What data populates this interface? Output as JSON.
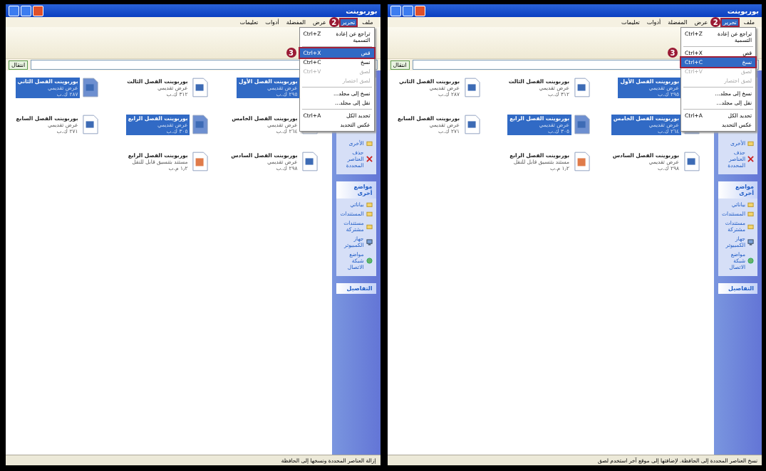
{
  "left_window": {
    "title": "بوربوينت",
    "menu": [
      {
        "label": "ملف",
        "selected": false
      },
      {
        "label": "تحرير",
        "selected": true
      },
      {
        "label": "عرض",
        "selected": false
      },
      {
        "label": "المفضلة",
        "selected": false
      },
      {
        "label": "أدوات",
        "selected": false
      },
      {
        "label": "تعليمات",
        "selected": false
      }
    ],
    "edit_menu": [
      {
        "kind": "item",
        "label": "تراجع عن إعادة التسمية",
        "shortcut": "Ctrl+Z",
        "selected": false,
        "disabled": false
      },
      {
        "kind": "separator"
      },
      {
        "kind": "item",
        "label": "قص",
        "shortcut": "Ctrl+X",
        "selected": true,
        "disabled": false
      },
      {
        "kind": "item",
        "label": "نسخ",
        "shortcut": "Ctrl+C",
        "selected": false,
        "disabled": false
      },
      {
        "kind": "item",
        "label": "لصق",
        "shortcut": "Ctrl+V",
        "selected": false,
        "disabled": true
      },
      {
        "kind": "item",
        "label": "لصق اختصار",
        "selected": false,
        "disabled": true
      },
      {
        "kind": "separator"
      },
      {
        "kind": "item",
        "label": "نسخ إلى مجلد...",
        "selected": false,
        "disabled": false
      },
      {
        "kind": "item",
        "label": "نقل إلى مجلد...",
        "selected": false,
        "disabled": false
      },
      {
        "kind": "separator"
      },
      {
        "kind": "item",
        "label": "تحديد الكل",
        "shortcut": "Ctrl+A",
        "selected": false,
        "disabled": false
      },
      {
        "kind": "item",
        "label": "عكس التحديد",
        "selected": false,
        "disabled": false
      }
    ],
    "step_badges": [
      "2",
      "3"
    ],
    "go_button": "انتقال",
    "panels": [
      {
        "items": [
          {
            "kind": "folder",
            "label": "الأخرى"
          },
          {
            "kind": "delete",
            "label": "حذف العناصر المحددة"
          }
        ]
      },
      {
        "title": "مواضع أخرى",
        "items": [
          {
            "kind": "folder",
            "label": "بياناتي"
          },
          {
            "kind": "folder",
            "label": "المستندات"
          },
          {
            "kind": "folder",
            "label": "مستندات مشتركة"
          },
          {
            "kind": "computer",
            "label": "جهاز الكمبيوتر"
          },
          {
            "kind": "network",
            "label": "مواضع شبكة الاتصال"
          }
        ]
      },
      {
        "title": "التفاصيل"
      }
    ],
    "files": [
      {
        "name": "بوربوينت الفصل الأول",
        "type": "عرض تقديمي",
        "size": "٢٩٥ ك.ب",
        "selected": true,
        "kind": "slides"
      },
      {
        "name": "بوربوينت الفصل الثالث",
        "type": "عرض تقديمي",
        "size": "٣١٢ ك.ب",
        "selected": false,
        "kind": "slides"
      },
      {
        "name": "بوربوينت الفصل الثاني",
        "type": "عرض تقديمي",
        "size": "٢٨٧ ك.ب",
        "selected": true,
        "kind": "slides"
      },
      {
        "name": "بوربوينت الفصل الخامس",
        "type": "عرض تقديمي",
        "size": "٢٦٤ ك.ب",
        "selected": false,
        "kind": "slides"
      },
      {
        "name": "بوربوينت الفصل الرابع",
        "type": "عرض تقديمي",
        "size": "٣٠٥ ك.ب",
        "selected": true,
        "kind": "slides"
      },
      {
        "name": "بوربوينت الفصل السابع",
        "type": "عرض تقديمي",
        "size": "٢٧١ ك.ب",
        "selected": false,
        "kind": "slides"
      },
      {
        "name": "بوربوينت الفصل السادس",
        "type": "عرض تقديمي",
        "size": "٢٩٨ ك.ب",
        "selected": false,
        "kind": "slides"
      },
      {
        "name": "بوربوينت الفصل الرابع",
        "type": "مستند بتنسيق قابل للنقل",
        "size": "١٫٢ م.ب",
        "selected": false,
        "kind": "pdf"
      }
    ],
    "status": "إزالة العناصر المحددة ونسخها إلى الحافظة"
  },
  "right_window": {
    "title": "بوربوينت",
    "menu": [
      {
        "label": "ملف",
        "selected": false
      },
      {
        "label": "تحرير",
        "selected": true
      },
      {
        "label": "عرض",
        "selected": false
      },
      {
        "label": "المفضلة",
        "selected": false
      },
      {
        "label": "أدوات",
        "selected": false
      },
      {
        "label": "تعليمات",
        "selected": false
      }
    ],
    "edit_menu": [
      {
        "kind": "item",
        "label": "تراجع عن إعادة التسمية",
        "shortcut": "Ctrl+Z",
        "selected": false,
        "disabled": false
      },
      {
        "kind": "separator"
      },
      {
        "kind": "item",
        "label": "قص",
        "shortcut": "Ctrl+X",
        "selected": false,
        "disabled": false
      },
      {
        "kind": "item",
        "label": "نسخ",
        "shortcut": "Ctrl+C",
        "selected": true,
        "disabled": false
      },
      {
        "kind": "item",
        "label": "لصق",
        "shortcut": "Ctrl+V",
        "selected": false,
        "disabled": true
      },
      {
        "kind": "item",
        "label": "لصق اختصار",
        "selected": false,
        "disabled": true
      },
      {
        "kind": "separator"
      },
      {
        "kind": "item",
        "label": "نسخ إلى مجلد...",
        "selected": false,
        "disabled": false
      },
      {
        "kind": "item",
        "label": "نقل إلى مجلد...",
        "selected": false,
        "disabled": false
      },
      {
        "kind": "separator"
      },
      {
        "kind": "item",
        "label": "تحديد الكل",
        "shortcut": "Ctrl+A",
        "selected": false,
        "disabled": false
      },
      {
        "kind": "item",
        "label": "عكس التحديد",
        "selected": false,
        "disabled": false
      }
    ],
    "step_badges": [
      "2",
      "3"
    ],
    "go_button": "انتقال",
    "panels": [
      {
        "items": [
          {
            "kind": "folder",
            "label": "الأخرى"
          },
          {
            "kind": "delete",
            "label": "حذف العناصر المحددة"
          }
        ]
      },
      {
        "title": "مواضع أخرى",
        "items": [
          {
            "kind": "folder",
            "label": "بياناتي"
          },
          {
            "kind": "folder",
            "label": "المستندات"
          },
          {
            "kind": "folder",
            "label": "مستندات مشتركة"
          },
          {
            "kind": "computer",
            "label": "جهاز الكمبيوتر"
          },
          {
            "kind": "network",
            "label": "مواضع شبكة الاتصال"
          }
        ]
      },
      {
        "title": "التفاصيل"
      }
    ],
    "files": [
      {
        "name": "بوربوينت الفصل الأول",
        "type": "عرض تقديمي",
        "size": "٢٩٥ ك.ب",
        "selected": true,
        "kind": "slides"
      },
      {
        "name": "بوربوينت الفصل الثالث",
        "type": "عرض تقديمي",
        "size": "٣١٢ ك.ب",
        "selected": false,
        "kind": "slides"
      },
      {
        "name": "بوربوينت الفصل الثاني",
        "type": "عرض تقديمي",
        "size": "٢٨٧ ك.ب",
        "selected": false,
        "kind": "slides"
      },
      {
        "name": "بوربوينت الفصل الخامس",
        "type": "عرض تقديمي",
        "size": "٢٦٤ ك.ب",
        "selected": true,
        "kind": "slides"
      },
      {
        "name": "بوربوينت الفصل الرابع",
        "type": "عرض تقديمي",
        "size": "٣٠٥ ك.ب",
        "selected": true,
        "kind": "slides"
      },
      {
        "name": "بوربوينت الفصل السابع",
        "type": "عرض تقديمي",
        "size": "٢٧١ ك.ب",
        "selected": false,
        "kind": "slides"
      },
      {
        "name": "بوربوينت الفصل السادس",
        "type": "عرض تقديمي",
        "size": "٢٩٨ ك.ب",
        "selected": false,
        "kind": "slides"
      },
      {
        "name": "بوربوينت الفصل الرابع",
        "type": "مستند بتنسيق قابل للنقل",
        "size": "١٫٢ م.ب",
        "selected": false,
        "kind": "pdf"
      }
    ],
    "status": "نسخ العناصر المحددة إلى الحافظة. لإضافتها إلى موقع آخر استخدم لصق"
  }
}
